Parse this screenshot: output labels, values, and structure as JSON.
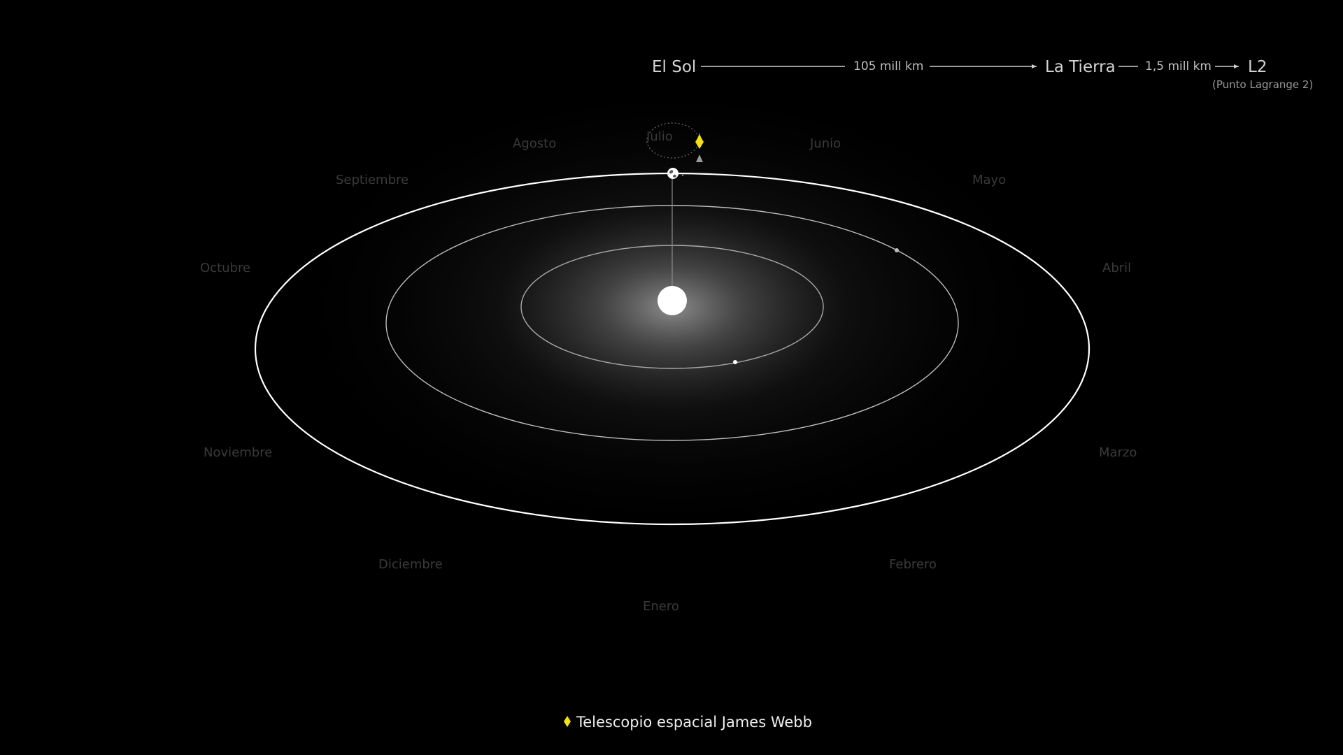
{
  "distance_bar": {
    "sun_label": "El Sol",
    "sun_distance": "105 mill km",
    "earth_label": "La Tierra",
    "l2_distance": "1,5 mill km",
    "l2_label": "L2",
    "l2_note": "(Punto Lagrange 2)"
  },
  "months": {
    "julio": "Julio",
    "agosto": "Agosto",
    "junio": "Junio",
    "septiembre": "Septiembre",
    "mayo": "Mayo",
    "octubre": "Octubre",
    "abril": "Abril",
    "noviembre": "Noviembre",
    "marzo": "Marzo",
    "diciembre": "Diciembre",
    "febrero": "Febrero",
    "enero": "Enero"
  },
  "legend": {
    "label": "Telescopio espacial James Webb",
    "icon": "yellow-diamond-icon"
  },
  "colors": {
    "background": "#000000",
    "telescope": "#f5e20a",
    "sun": "#ffffff",
    "orbit": "#ffffff"
  }
}
